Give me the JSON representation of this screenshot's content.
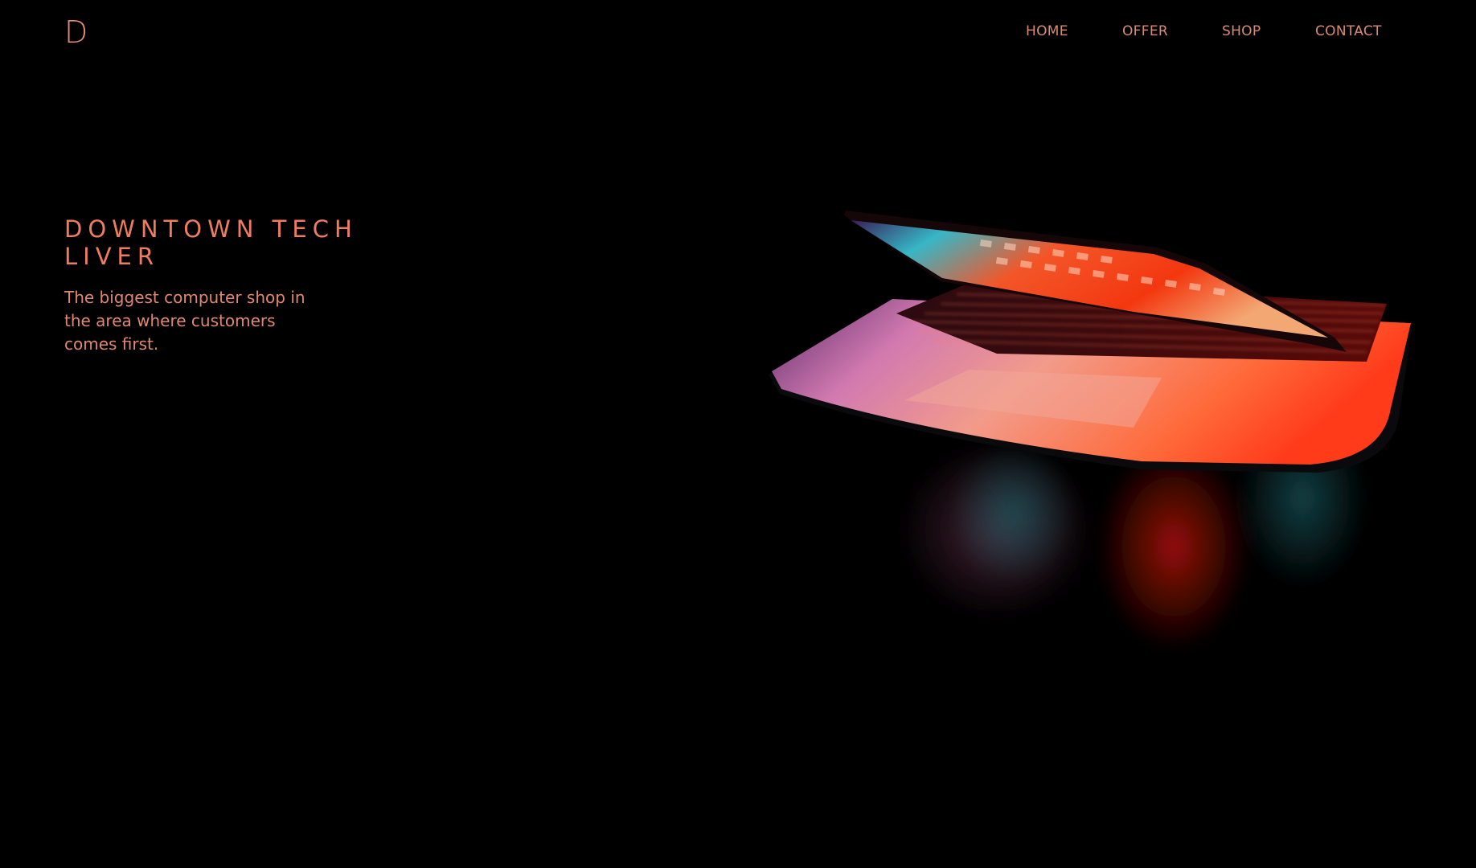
{
  "header": {
    "logo": "D",
    "nav": {
      "home": "HOME",
      "offer": "OFFER",
      "shop": "SHOP",
      "contact": "CONTACT"
    }
  },
  "hero": {
    "title": "DOWNTOWN TECH LIVER",
    "text": "The biggest computer shop in the area where customers comes first.",
    "image": "glowing-laptop-photo"
  },
  "colors": {
    "background": "#000000",
    "accent": "#f07c60",
    "nav_text": "#d98a73"
  }
}
